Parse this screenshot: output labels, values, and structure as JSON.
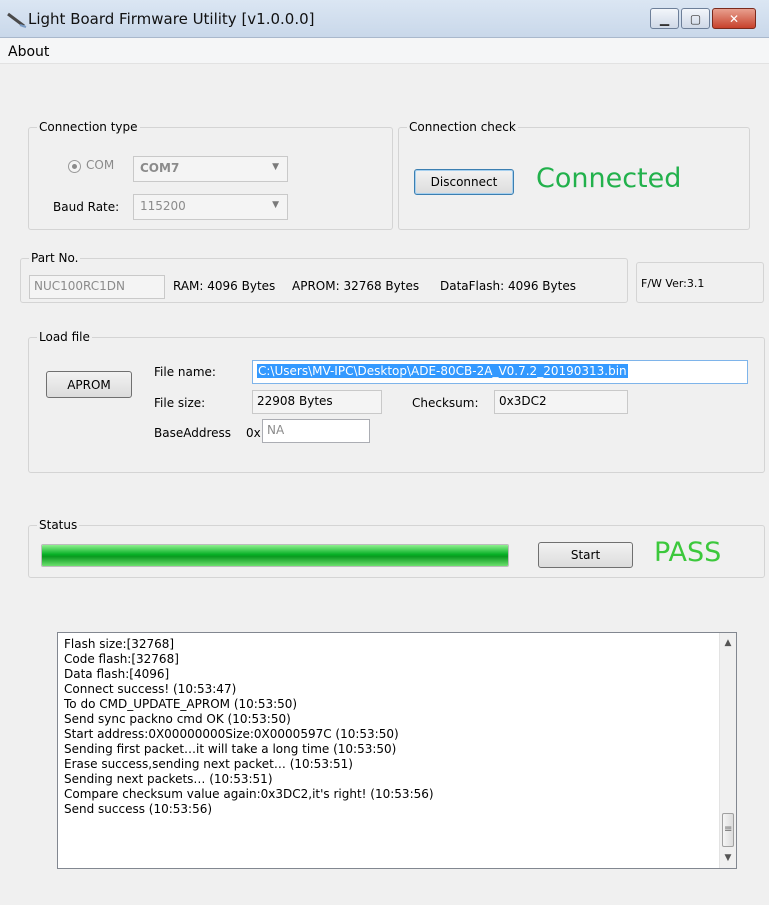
{
  "window": {
    "title": "Light Board Firmware Utility  [v1.0.0.0]",
    "icons": [
      "app-icon",
      "minimize-icon",
      "maximize-icon",
      "close-icon"
    ]
  },
  "menu": {
    "about": "About"
  },
  "connection_type": {
    "legend": "Connection type",
    "com_label": "COM",
    "com_port": "COM7",
    "baud_label": "Baud Rate:",
    "baud_rate": "115200"
  },
  "connection_check": {
    "legend": "Connection check",
    "disconnect_label": "Disconnect",
    "status": "Connected",
    "status_color": "#22b14c"
  },
  "part": {
    "legend": "Part No.",
    "part_no": "NUC100RC1DN",
    "ram": "RAM: 4096 Bytes",
    "aprom": "APROM: 32768 Bytes",
    "dataflash": "DataFlash: 4096 Bytes",
    "fw_ver": "F/W Ver:3.1"
  },
  "load_file": {
    "legend": "Load file",
    "aprom_button": "APROM",
    "file_name_label": "File name:",
    "file_name": "C:\\Users\\MV-IPC\\Desktop\\ADE-80CB-2A_V0.7.2_20190313.bin",
    "file_size_label": "File size:",
    "file_size": "22908 Bytes",
    "checksum_label": "Checksum:",
    "checksum": "0x3DC2",
    "base_address_label": "BaseAddress",
    "base_prefix": "0x",
    "base_address": "NA"
  },
  "status": {
    "legend": "Status",
    "progress": 1.0,
    "start_label": "Start",
    "result": "PASS",
    "result_color": "#3cc83c"
  },
  "log": {
    "lines": [
      "Flash size:[32768]",
      "Code flash:[32768]",
      "Data flash:[4096]",
      "Connect success! (10:53:47)",
      "To do CMD_UPDATE_APROM (10:53:50)",
      "Send sync packno cmd OK (10:53:50)",
      "Start address:0X00000000Size:0X0000597C (10:53:50)",
      "Sending first packet…it will take a long time (10:53:50)",
      "Erase success,sending next packet… (10:53:51)",
      "Sending next packets… (10:53:51)",
      "Compare checksum value again:0x3DC2,it's right! (10:53:56)",
      "Send success (10:53:56)"
    ]
  }
}
